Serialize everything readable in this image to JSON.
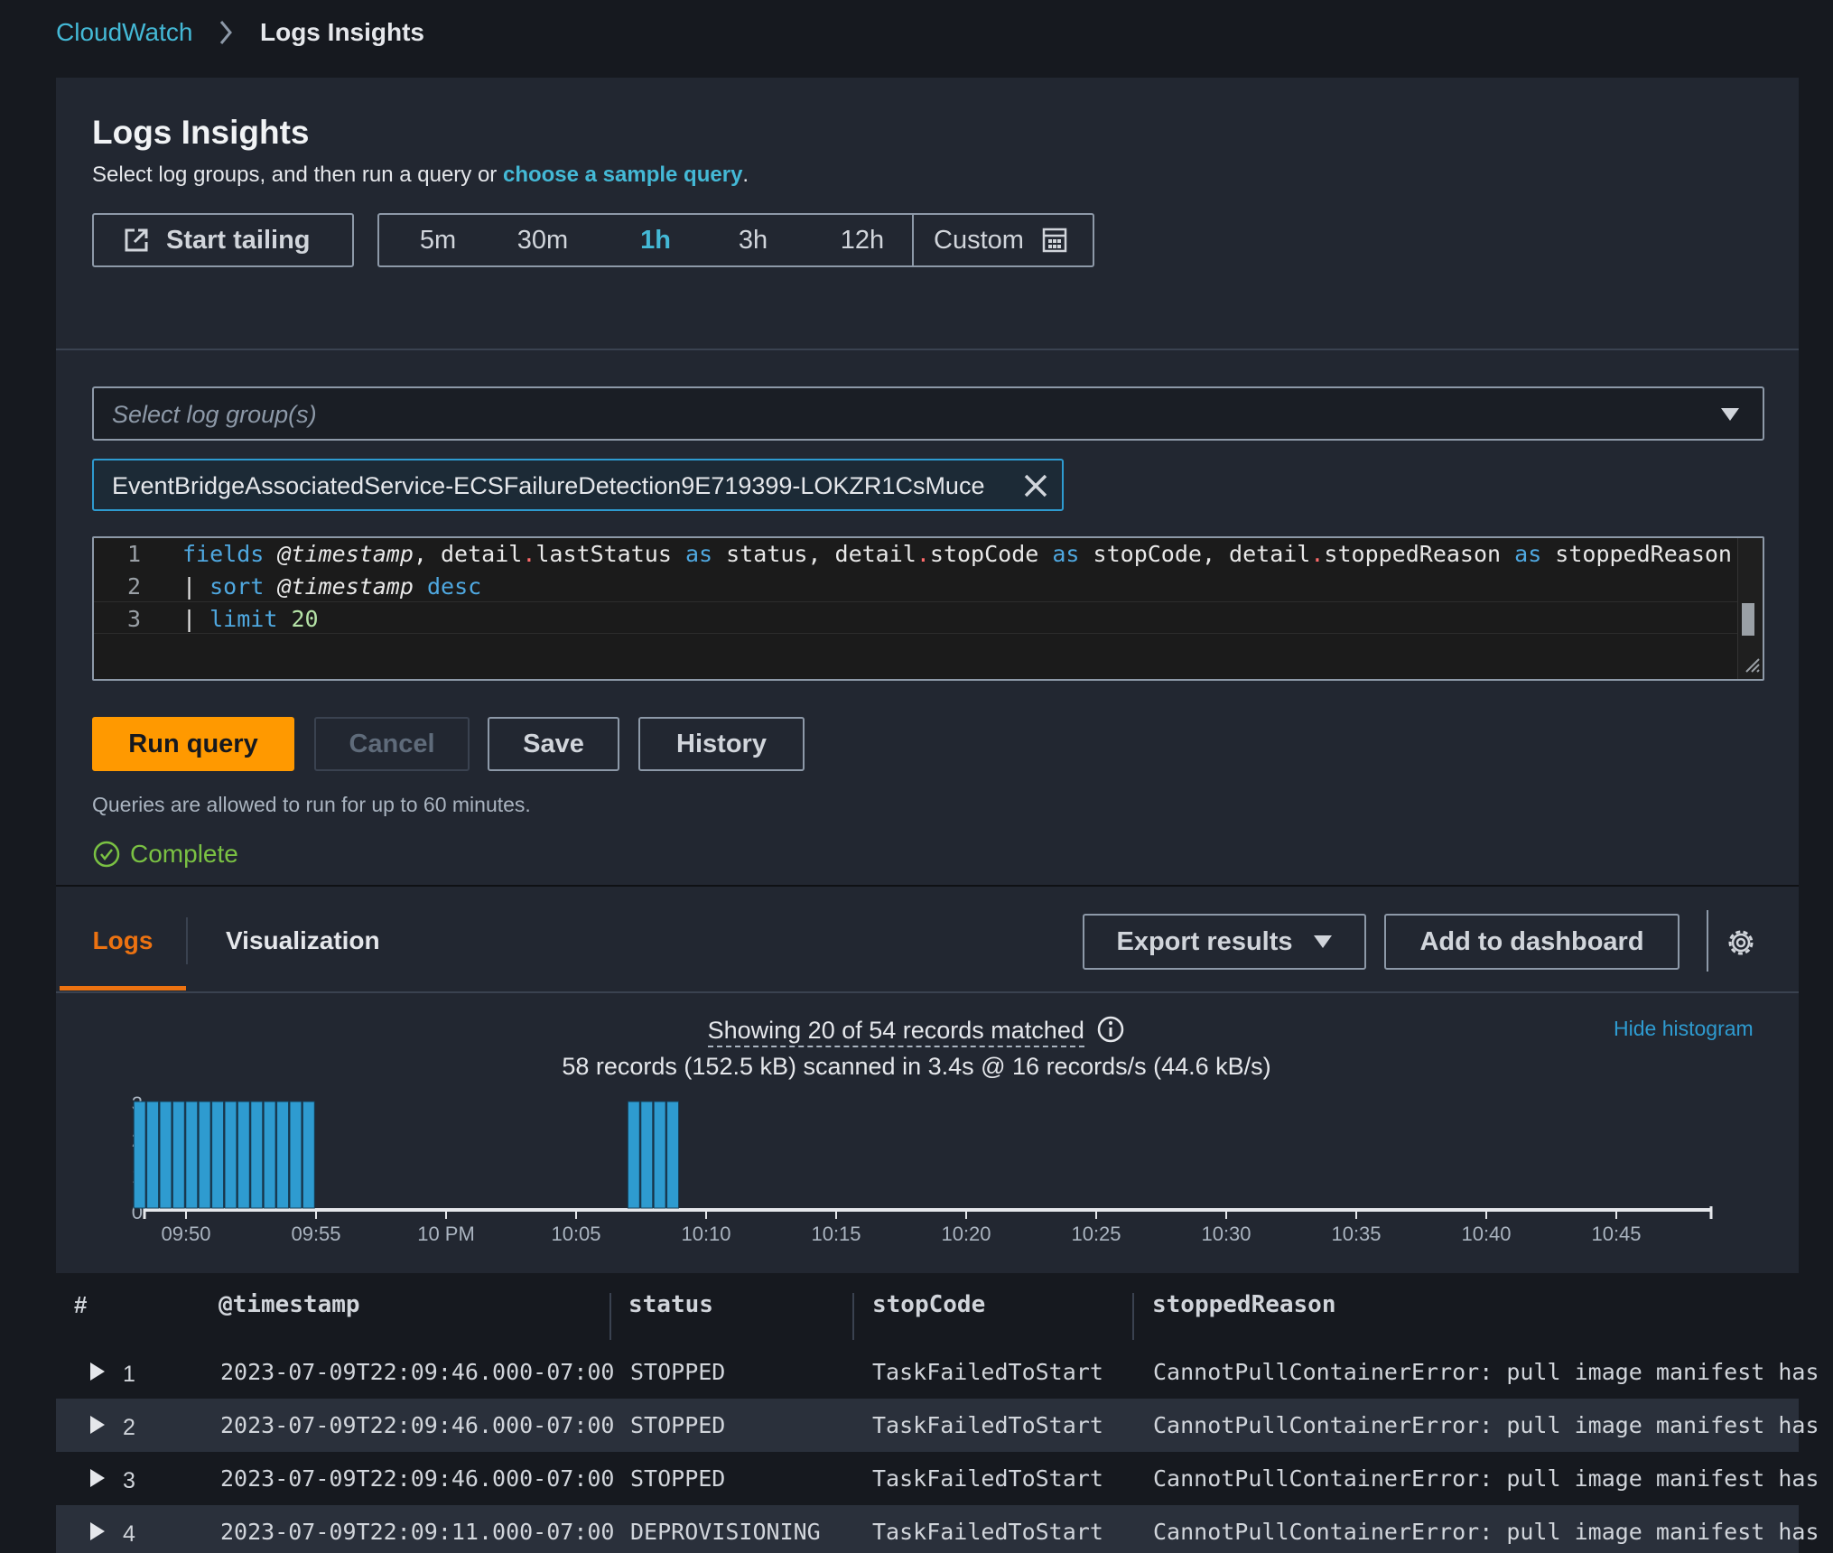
{
  "breadcrumb": {
    "root": "CloudWatch",
    "current": "Logs Insights"
  },
  "header": {
    "title": "Logs Insights",
    "subtitle_prefix": "Select log groups, and then run a query or ",
    "subtitle_link": "choose a sample query",
    "subtitle_suffix": "."
  },
  "start_tailing_label": "Start tailing",
  "time_ranges": [
    "5m",
    "30m",
    "1h",
    "3h",
    "12h"
  ],
  "time_range_selected": "1h",
  "custom_label": "Custom",
  "log_group_select": {
    "placeholder": "Select log group(s)"
  },
  "selected_log_group": "EventBridgeAssociatedService-ECSFailureDetection9E719399-LOKZR1CsMuce",
  "query_editor": {
    "line_numbers": [
      "1",
      "2",
      "3"
    ]
  },
  "actions": {
    "run": "Run query",
    "cancel": "Cancel",
    "save": "Save",
    "history": "History"
  },
  "query_note": "Queries are allowed to run for up to 60 minutes.",
  "status": {
    "label": "Complete",
    "color": "#7ac143"
  },
  "tabs": {
    "logs": "Logs",
    "visualization": "Visualization",
    "active": "Logs"
  },
  "results_toolbar": {
    "export": "Export results",
    "add_dashboard": "Add to dashboard"
  },
  "summary": {
    "showing": "Showing 20 of 54 records matched",
    "scanned": "58 records (152.5 kB) scanned in 3.4s @ 16 records/s (44.6 kB/s)",
    "hide_histogram": "Hide histogram"
  },
  "histogram": {
    "y_ticks": [
      "3",
      "2",
      "1",
      "0"
    ],
    "x_ticks": [
      "09:50",
      "09:55",
      "10 PM",
      "10:05",
      "10:10",
      "10:15",
      "10:20",
      "10:25",
      "10:30",
      "10:35",
      "10:40",
      "10:45"
    ],
    "bar_color": "#2e9bd0"
  },
  "chart_data": {
    "type": "bar",
    "title": "",
    "xlabel": "",
    "ylabel": "",
    "ylim": [
      0,
      3
    ],
    "categories": [
      "09:49",
      "09:49:30",
      "09:50",
      "09:50:30",
      "09:51",
      "09:51:30",
      "09:52",
      "09:52:30",
      "09:53",
      "09:53:30",
      "09:54",
      "09:54:30",
      "09:55",
      "09:55:30",
      "10:08",
      "10:08:30",
      "10:09",
      "10:09:30"
    ],
    "values": [
      3,
      3,
      3,
      3,
      3,
      3,
      3,
      3,
      3,
      3,
      3,
      3,
      3,
      3,
      3,
      3,
      3,
      3
    ]
  },
  "table": {
    "columns": [
      "#",
      "@timestamp",
      "status",
      "stopCode",
      "stoppedReason"
    ],
    "rows": [
      {
        "n": "1",
        "timestamp": "2023-07-09T22:09:46.000-07:00",
        "status": "STOPPED",
        "stopCode": "TaskFailedToStart",
        "reason": "CannotPullContainerError: pull image manifest has"
      },
      {
        "n": "2",
        "timestamp": "2023-07-09T22:09:46.000-07:00",
        "status": "STOPPED",
        "stopCode": "TaskFailedToStart",
        "reason": "CannotPullContainerError: pull image manifest has"
      },
      {
        "n": "3",
        "timestamp": "2023-07-09T22:09:46.000-07:00",
        "status": "STOPPED",
        "stopCode": "TaskFailedToStart",
        "reason": "CannotPullContainerError: pull image manifest has"
      },
      {
        "n": "4",
        "timestamp": "2023-07-09T22:09:11.000-07:00",
        "status": "DEPROVISIONING",
        "stopCode": "TaskFailedToStart",
        "reason": "CannotPullContainerError: pull image manifest has"
      }
    ]
  }
}
